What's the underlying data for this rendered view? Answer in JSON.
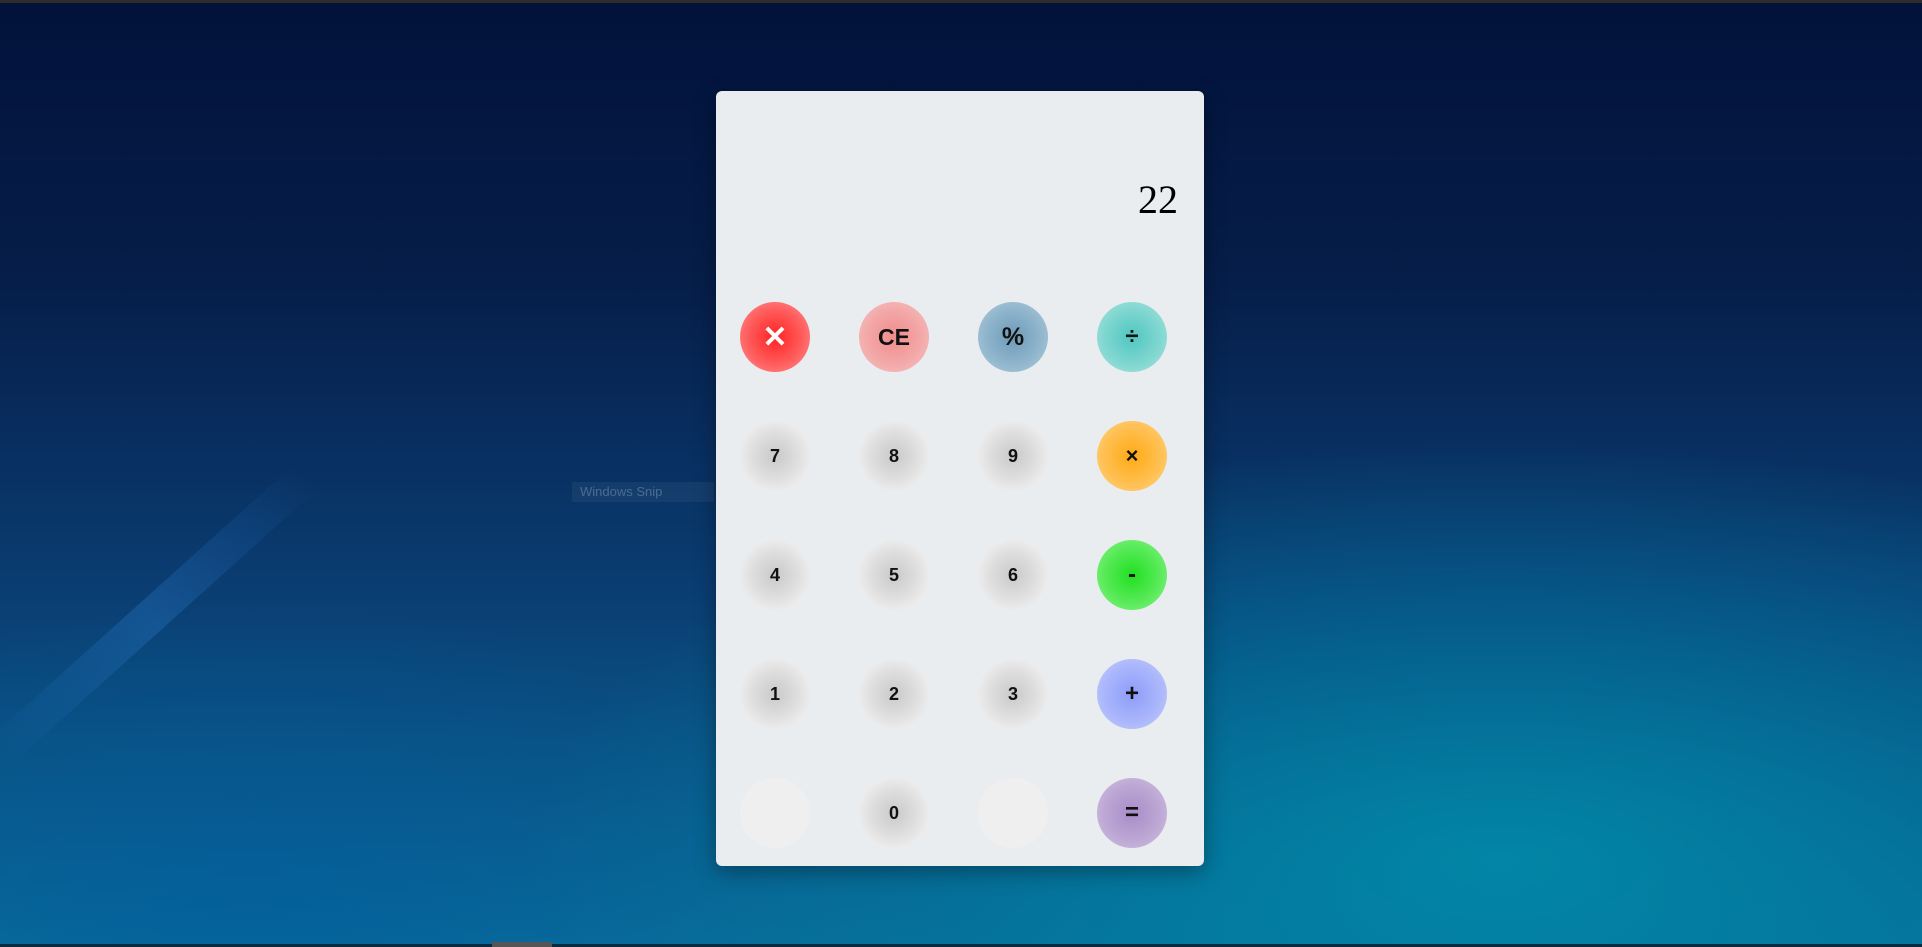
{
  "display": {
    "value": "22"
  },
  "desktop": {
    "ghost_label": "Windows Snip"
  },
  "buttons": {
    "row1": [
      {
        "label": "✕",
        "icon": "close-icon"
      },
      {
        "label": "CE"
      },
      {
        "label": "%"
      },
      {
        "label": "÷"
      }
    ],
    "row2": [
      {
        "label": "7"
      },
      {
        "label": "8"
      },
      {
        "label": "9"
      },
      {
        "label": "×"
      }
    ],
    "row3": [
      {
        "label": "4"
      },
      {
        "label": "5"
      },
      {
        "label": "6"
      },
      {
        "label": "-"
      }
    ],
    "row4": [
      {
        "label": "1"
      },
      {
        "label": "2"
      },
      {
        "label": "3"
      },
      {
        "label": "+"
      }
    ],
    "row5": [
      {
        "label": ""
      },
      {
        "label": "0"
      },
      {
        "label": ""
      },
      {
        "label": "="
      }
    ]
  },
  "colors": {
    "cancel": "#ff2222",
    "ce": "#f08c8c",
    "percent": "#6d9ab8",
    "divide": "#4fc7c0",
    "multiply": "#ffa914",
    "minus": "#22e022",
    "plus": "#8d9dfa",
    "equals": "#a88cc8",
    "panel": "#eaedf0"
  }
}
